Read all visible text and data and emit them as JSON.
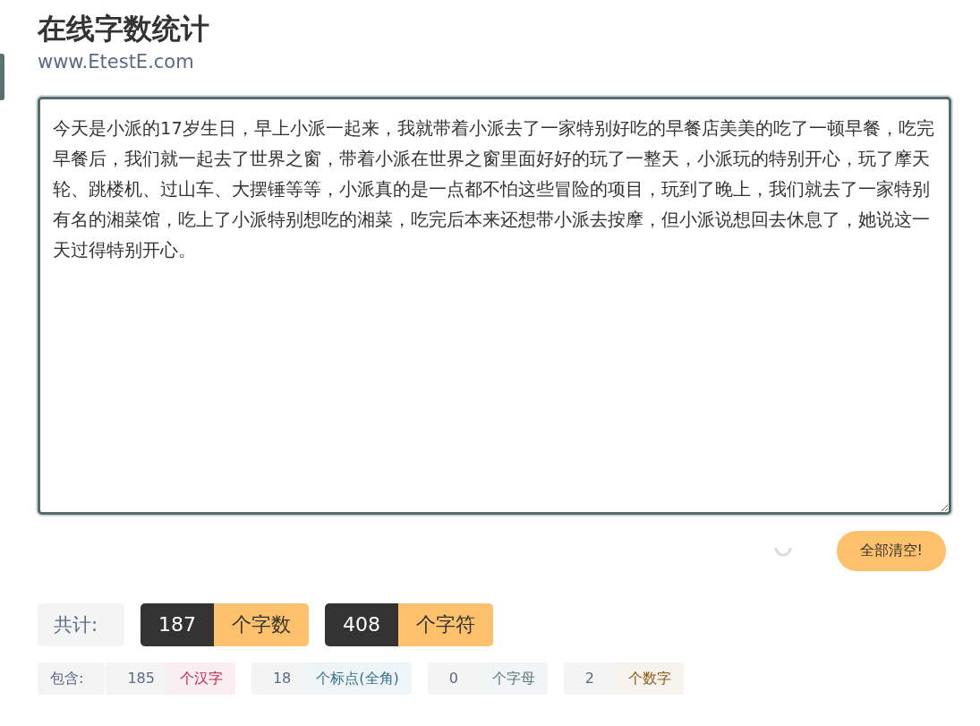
{
  "header": {
    "title": "在线字数统计",
    "subtitle": "www.EtestE.com"
  },
  "editor": {
    "value": "今天是小派的17岁生日，早上小派一起来，我就带着小派去了一家特别好吃的早餐店美美的吃了一顿早餐，吃完早餐后，我们就一起去了世界之窗，带着小派在世界之窗里面好好的玩了一整天，小派玩的特别开心，玩了摩天轮、跳楼机、过山车、大摆锤等等，小派真的是一点都不怕这些冒险的项目，玩到了晚上，我们就去了一家特别有名的湘菜馆，吃上了小派特别想吃的湘菜，吃完后本来还想带小派去按摩，但小派说想回去休息了，她说这一天过得特别开心。"
  },
  "clear_button": "全部清空!",
  "totals": {
    "label": "共计:",
    "items": [
      {
        "count": "187",
        "unit": "个字数"
      },
      {
        "count": "408",
        "unit": "个字符"
      }
    ]
  },
  "details": {
    "label": "包含:",
    "items": [
      {
        "count": "185",
        "unit": "个汉字",
        "color": "#c7254e"
      },
      {
        "count": "18",
        "unit": "个标点(全角)",
        "color": "#31708f"
      },
      {
        "count": "0",
        "unit": "个字母",
        "color": "#5b7a7e"
      },
      {
        "count": "2",
        "unit": "个数字",
        "color": "#8a5a14"
      }
    ]
  }
}
